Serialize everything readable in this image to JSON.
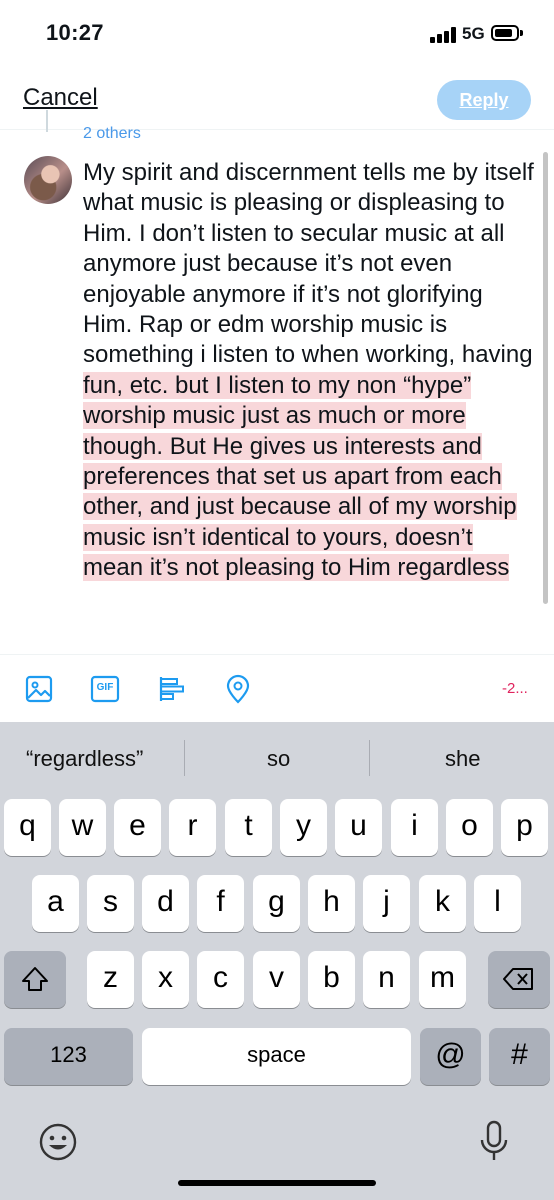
{
  "status_bar": {
    "time": "10:27",
    "network": "5G"
  },
  "header": {
    "cancel_label": "Cancel",
    "reply_label": "Reply"
  },
  "reply_context": "2 others",
  "compose": {
    "text_before_highlight": "My spirit and discernment tells me by itself what music is pleasing or displeasing to Him. I don’t listen to secular music at all anymore just because it’s not even enjoyable anymore if it’s not glorifying Him. Rap or edm worship music is something i listen to when working, having ",
    "text_highlighted": "fun, etc. but I listen to my non “hype” worship music just as much or more though. But He gives us interests and preferences that set us apart from each other, and just because all of my worship music isn’t identical to yours, doesn’t mean it’s not pleasing to Him regardless"
  },
  "toolbar": {
    "icons": [
      "image-icon",
      "gif-icon",
      "poll-icon",
      "location-icon"
    ],
    "gif_label": "GIF",
    "char_count": "-2..."
  },
  "keyboard": {
    "suggestions": [
      "“regardless”",
      "so",
      "she"
    ],
    "row1": [
      "q",
      "w",
      "e",
      "r",
      "t",
      "y",
      "u",
      "i",
      "o",
      "p"
    ],
    "row2": [
      "a",
      "s",
      "d",
      "f",
      "g",
      "h",
      "j",
      "k",
      "l"
    ],
    "row3": [
      "z",
      "x",
      "c",
      "v",
      "b",
      "n",
      "m"
    ],
    "numbers_label": "123",
    "space_label": "space",
    "at_label": "@",
    "hash_label": "#"
  },
  "colors": {
    "accent": "#1d9bf0",
    "reply_disabled": "#a7d3f7",
    "highlight": "#f8d7da",
    "over_limit": "#e0245e"
  }
}
